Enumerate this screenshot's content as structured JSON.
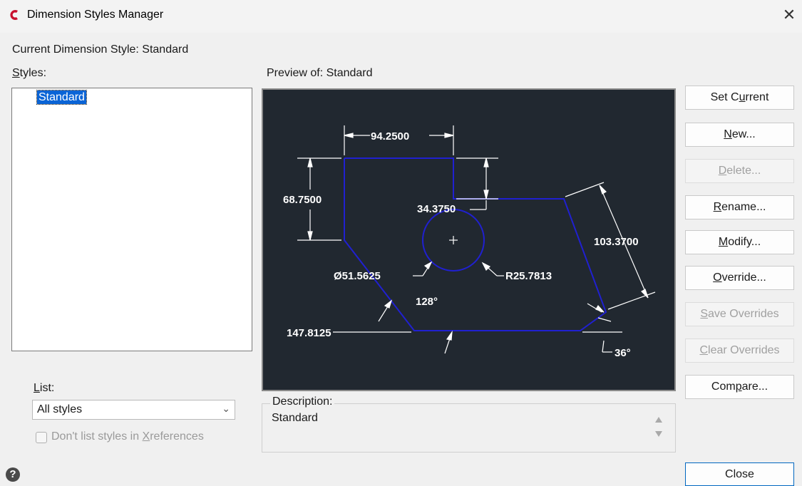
{
  "window": {
    "title": "Dimension Styles Manager",
    "close_glyph": "✕"
  },
  "current_style_label": "Current Dimension Style: Standard",
  "styles": {
    "label_u": "S",
    "label_rest": "tyles:",
    "items": [
      "Standard"
    ]
  },
  "preview": {
    "label": "Preview of: Standard",
    "dims": {
      "top": "94.2500",
      "left": "68.7500",
      "step": "34.3750",
      "diag": "103.3700",
      "diameter": "Ø51.5625",
      "radius": "R25.7813",
      "angle": "128°",
      "bottom": "147.8125",
      "small_angle": "36°"
    }
  },
  "buttons": [
    {
      "pre": "Set C",
      "u": "u",
      "post": "rrent",
      "disabled": false
    },
    {
      "pre": "",
      "u": "N",
      "post": "ew...",
      "disabled": false
    },
    {
      "pre": "",
      "u": "D",
      "post": "elete...",
      "disabled": true
    },
    {
      "pre": "",
      "u": "R",
      "post": "ename...",
      "disabled": false
    },
    {
      "pre": "",
      "u": "M",
      "post": "odify...",
      "disabled": false
    },
    {
      "pre": "",
      "u": "O",
      "post": "verride...",
      "disabled": false
    },
    {
      "pre": "",
      "u": "S",
      "post": "ave Overrides",
      "disabled": true
    },
    {
      "pre": "",
      "u": "C",
      "post": "lear Overrides",
      "disabled": true
    },
    {
      "pre": "Com",
      "u": "p",
      "post": "are...",
      "disabled": false
    }
  ],
  "list": {
    "label_u": "L",
    "label_rest": "ist:",
    "selected": "All styles"
  },
  "xref_checkbox": {
    "pre": "Don't list styles in ",
    "u": "X",
    "post": "references",
    "checked": false
  },
  "description": {
    "legend": "Description:",
    "text": "Standard"
  },
  "close_button": "Close",
  "help_glyph": "?",
  "colors": {
    "accent": "#0a64d6",
    "preview_bg": "#212830",
    "outline": "#1010c8"
  },
  "icons": {
    "app": "autocad-c-icon",
    "help": "help-icon",
    "close": "close-icon",
    "dropdown": "chevron-down-icon"
  }
}
